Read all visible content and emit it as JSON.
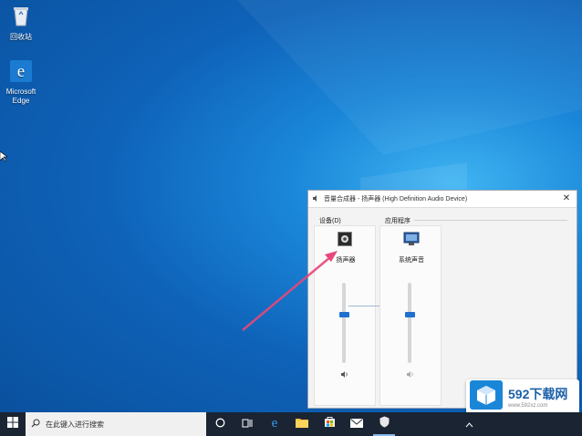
{
  "desktop": {
    "icons": [
      {
        "label": "回收站",
        "icon": "recycle-bin-icon"
      },
      {
        "label": "Microsoft Edge",
        "icon": "edge-icon"
      }
    ]
  },
  "mixer": {
    "title": "音量合成器 - 扬声器 (High Definition Audio Device)",
    "device_section": "设备(D)",
    "apps_section": "应用程序",
    "device_name": "扬声器",
    "app_name": "系统声音",
    "device_volume": 0.6,
    "app_volume": 0.6
  },
  "taskbar": {
    "search_placeholder": "在此键入进行搜索"
  },
  "watermark": {
    "brand": "592下载网",
    "url": "www.592xz.com"
  },
  "colors": {
    "accent": "#1e6fd0",
    "arrow": "#e8477a",
    "taskbar": "#1a2433"
  }
}
